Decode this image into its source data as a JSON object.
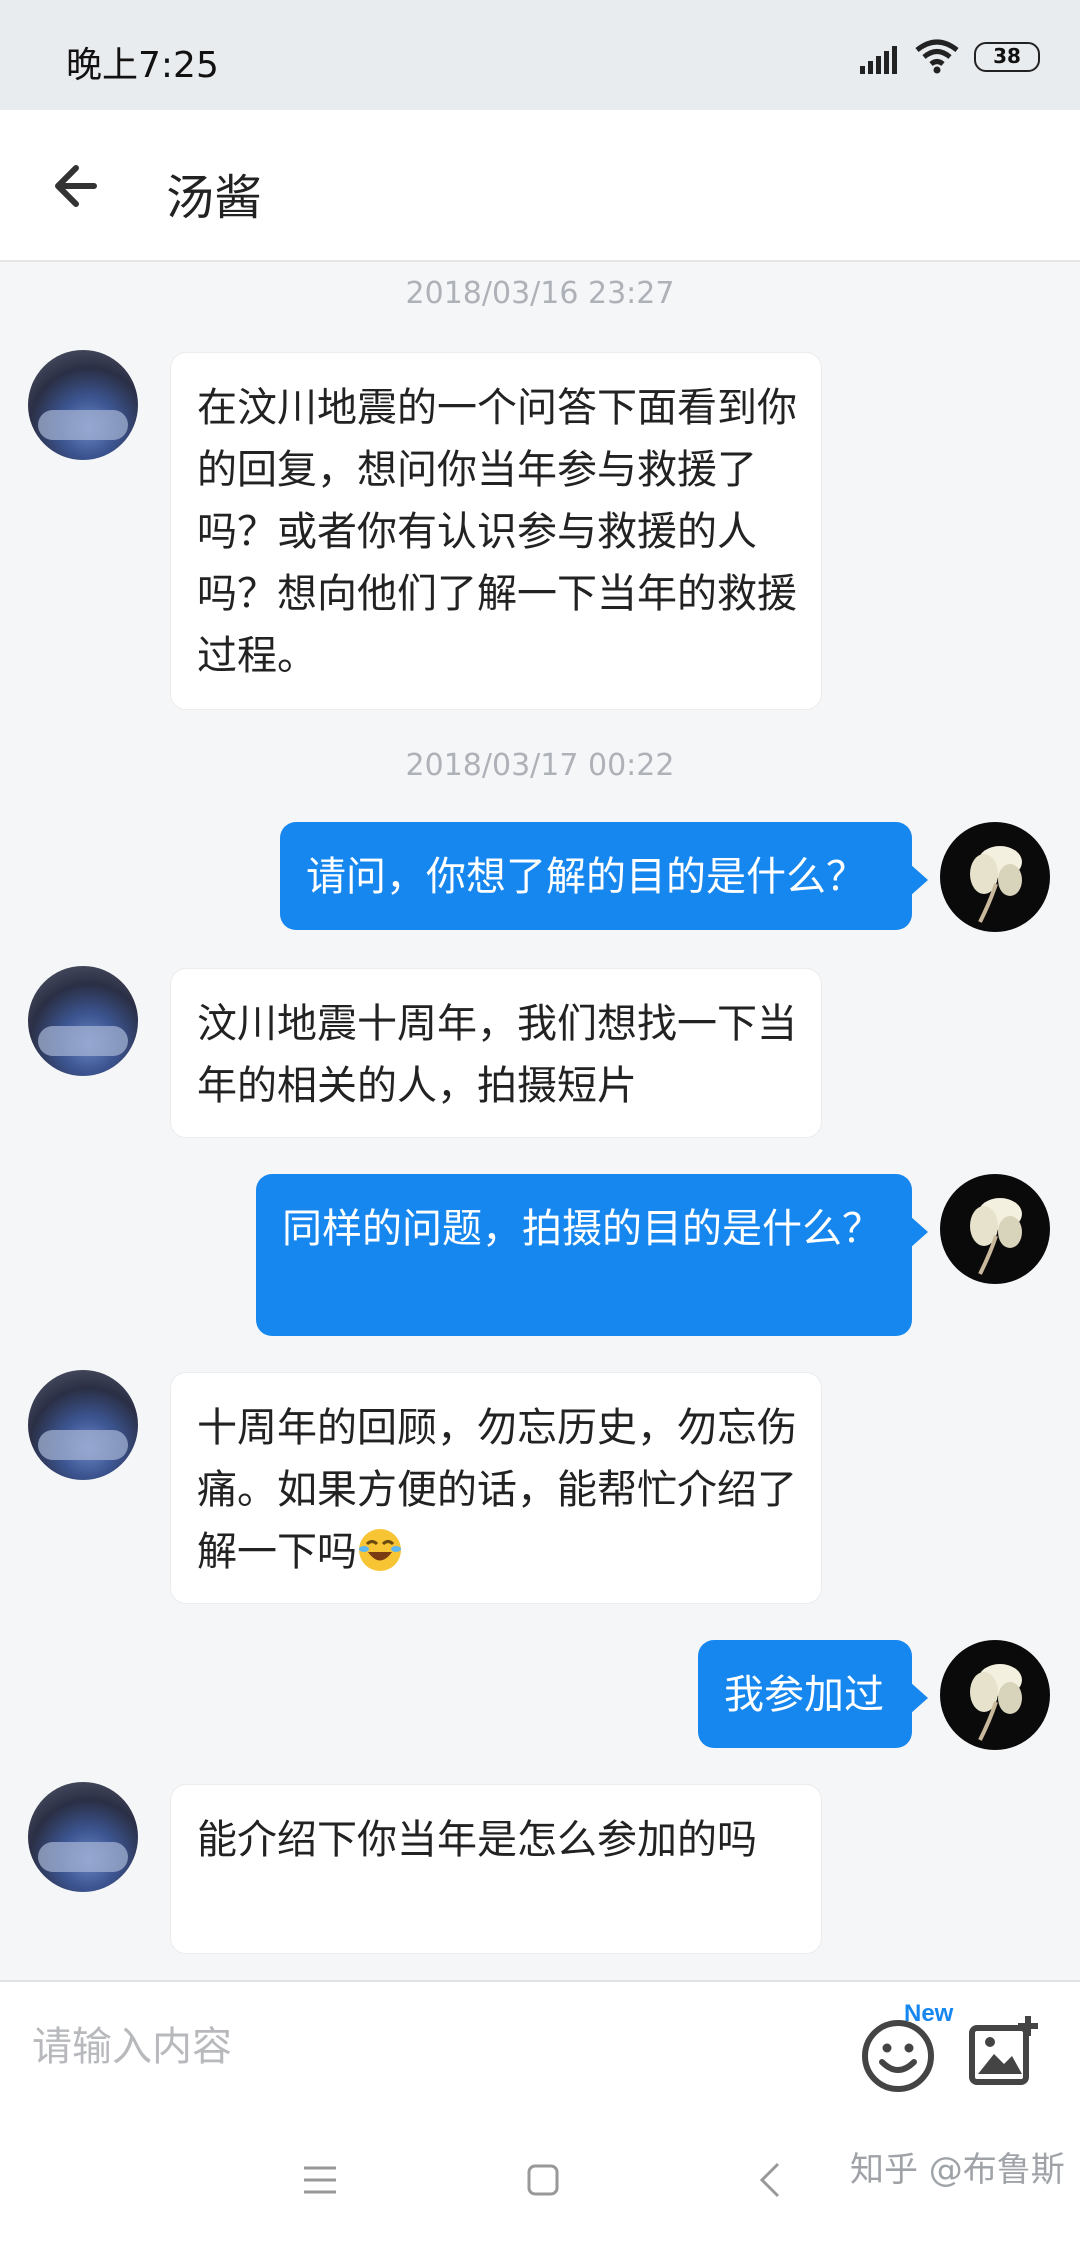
{
  "status_bar": {
    "time": "晚上7:25",
    "battery": "38"
  },
  "header": {
    "title": "汤酱"
  },
  "messages": [
    {
      "type": "timestamp",
      "text": "2018/03/16 23:27"
    },
    {
      "type": "other",
      "text": "在汶川地震的一个问答下面看到你的回复，想问你当年参与救援了吗？或者你有认识参与救援的人吗？想向他们了解一下当年的救援过程。"
    },
    {
      "type": "timestamp",
      "text": "2018/03/17 00:22"
    },
    {
      "type": "me",
      "text": "请问，你想了解的目的是什么？"
    },
    {
      "type": "other",
      "text": "汶川地震十周年，我们想找一下当年的相关的人，拍摄短片"
    },
    {
      "type": "me",
      "text": "同样的问题，拍摄的目的是什么？"
    },
    {
      "type": "other",
      "text": "十周年的回顾，勿忘历史，勿忘伤痛。如果方便的话，能帮忙介绍了解一下吗",
      "emoji": "laughing-crying-emoji"
    },
    {
      "type": "me",
      "text": "我参加过"
    },
    {
      "type": "other",
      "text": "能介绍下你当年是怎么参加的吗"
    }
  ],
  "input": {
    "placeholder": "请输入内容",
    "value": ""
  },
  "toolbar": {
    "new_badge": "New"
  },
  "icons": {
    "back": "arrow-left-icon",
    "emoji": "smiley-icon",
    "image": "image-add-icon",
    "menu": "menu-icon",
    "home": "square-home-icon",
    "nav_back": "chevron-left-icon"
  },
  "colors": {
    "accent": "#1787f0",
    "background": "#f5f6f8",
    "bubble_other": "#ffffff"
  },
  "watermark": "知乎 @布鲁斯"
}
